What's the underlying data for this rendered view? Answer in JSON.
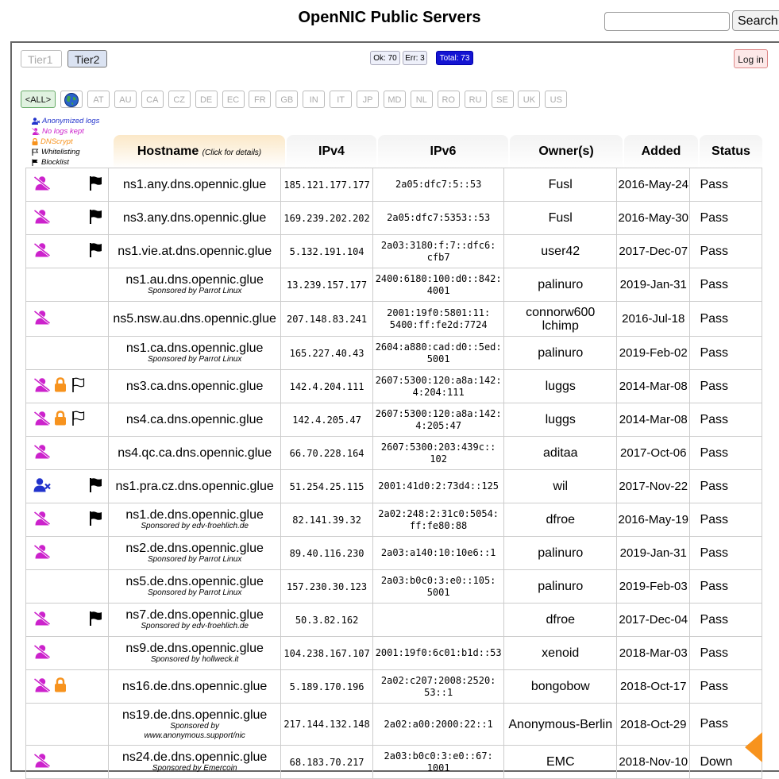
{
  "header": {
    "title": "OpenNIC Public Servers",
    "search_placeholder": "",
    "search_button": "Search"
  },
  "toolbar": {
    "tier1": "Tier1",
    "tier2": "Tier2",
    "stats": {
      "ok": "Ok: 70",
      "err": "Err: 3",
      "total": "Total: 73"
    },
    "login": "Log in"
  },
  "filters": {
    "all": "<ALL>",
    "countries": [
      "AT",
      "AU",
      "CA",
      "CZ",
      "DE",
      "EC",
      "FR",
      "GB",
      "IN",
      "IT",
      "JP",
      "MD",
      "NL",
      "RO",
      "RU",
      "SE",
      "UK",
      "US"
    ]
  },
  "legend": {
    "anonymized": "Anonymized logs",
    "no_logs": "No logs kept",
    "dnscrypt": "DNScrypt",
    "whitelisting": "Whitelisting",
    "blocklist": "Blocklist"
  },
  "colors": {
    "anonymized": "#2233cc",
    "no_logs": "#cc22cc",
    "dnscrypt": "#f7931e",
    "total_badge": "#1414d2",
    "down_arrow": "#f7931e"
  },
  "table": {
    "headers": {
      "hostname": "Hostname",
      "hostname_note": "(Click for details)",
      "ipv4": "IPv4",
      "ipv6": "IPv6",
      "owner": "Owner(s)",
      "added": "Added",
      "status": "Status"
    },
    "rows": [
      {
        "icons": [
          "no-logs",
          "",
          "blocklist"
        ],
        "host": "ns1.any.dns.opennic.glue",
        "sponsor": "",
        "ipv4": "185.121.177.177",
        "ipv6": [
          "2a05:dfc7:5::53"
        ],
        "owner": [
          "Fusl"
        ],
        "added": "2016-May-24",
        "status": "Pass"
      },
      {
        "icons": [
          "no-logs",
          "",
          "blocklist"
        ],
        "host": "ns3.any.dns.opennic.glue",
        "sponsor": "",
        "ipv4": "169.239.202.202",
        "ipv6": [
          "2a05:dfc7:5353::53"
        ],
        "owner": [
          "Fusl"
        ],
        "added": "2016-May-30",
        "status": "Pass"
      },
      {
        "icons": [
          "no-logs",
          "",
          "blocklist"
        ],
        "host": "ns1.vie.at.dns.opennic.glue",
        "sponsor": "",
        "ipv4": "5.132.191.104",
        "ipv6": [
          "2a03:3180:f:7::dfc6:",
          "cfb7"
        ],
        "owner": [
          "user42"
        ],
        "added": "2017-Dec-07",
        "status": "Pass"
      },
      {
        "icons": [
          "",
          "",
          ""
        ],
        "host": "ns1.au.dns.opennic.glue",
        "sponsor": "Sponsored by Parrot Linux",
        "ipv4": "13.239.157.177",
        "ipv6": [
          "2400:6180:100:d0::842:",
          "4001"
        ],
        "owner": [
          "palinuro"
        ],
        "added": "2019-Jan-31",
        "status": "Pass"
      },
      {
        "icons": [
          "no-logs",
          "",
          ""
        ],
        "host": "ns5.nsw.au.dns.opennic.glue",
        "sponsor": "",
        "ipv4": "207.148.83.241",
        "ipv6": [
          "2001:19f0:5801:11:",
          "5400:ff:fe2d:7724"
        ],
        "owner": [
          "connorw600",
          "lchimp"
        ],
        "added": "2016-Jul-18",
        "status": "Pass"
      },
      {
        "icons": [
          "",
          "",
          ""
        ],
        "host": "ns1.ca.dns.opennic.glue",
        "sponsor": "Sponsored by Parrot Linux",
        "ipv4": "165.227.40.43",
        "ipv6": [
          "2604:a880:cad:d0::5ed:",
          "5001"
        ],
        "owner": [
          "palinuro"
        ],
        "added": "2019-Feb-02",
        "status": "Pass"
      },
      {
        "icons": [
          "no-logs",
          "dnscrypt",
          "whitelist"
        ],
        "host": "ns3.ca.dns.opennic.glue",
        "sponsor": "",
        "ipv4": "142.4.204.111",
        "ipv6": [
          "2607:5300:120:a8a:142:",
          "4:204:111"
        ],
        "owner": [
          "luggs"
        ],
        "added": "2014-Mar-08",
        "status": "Pass"
      },
      {
        "icons": [
          "no-logs",
          "dnscrypt",
          "whitelist"
        ],
        "host": "ns4.ca.dns.opennic.glue",
        "sponsor": "",
        "ipv4": "142.4.205.47",
        "ipv6": [
          "2607:5300:120:a8a:142:",
          "4:205:47"
        ],
        "owner": [
          "luggs"
        ],
        "added": "2014-Mar-08",
        "status": "Pass"
      },
      {
        "icons": [
          "no-logs",
          "",
          ""
        ],
        "host": "ns4.qc.ca.dns.opennic.glue",
        "sponsor": "",
        "ipv4": "66.70.228.164",
        "ipv6": [
          "2607:5300:203:439c::",
          "102"
        ],
        "owner": [
          "aditaa"
        ],
        "added": "2017-Oct-06",
        "status": "Pass"
      },
      {
        "icons": [
          "anonymized",
          "",
          "blocklist"
        ],
        "host": "ns1.pra.cz.dns.opennic.glue",
        "sponsor": "",
        "ipv4": "51.254.25.115",
        "ipv6": [
          "2001:41d0:2:73d4::125"
        ],
        "owner": [
          "wil"
        ],
        "added": "2017-Nov-22",
        "status": "Pass"
      },
      {
        "icons": [
          "no-logs",
          "",
          "blocklist"
        ],
        "host": "ns1.de.dns.opennic.glue",
        "sponsor": "Sponsored by edv-froehlich.de",
        "ipv4": "82.141.39.32",
        "ipv6": [
          "2a02:248:2:31c0:5054:",
          "ff:fe80:88"
        ],
        "owner": [
          "dfroe"
        ],
        "added": "2016-May-19",
        "status": "Pass"
      },
      {
        "icons": [
          "no-logs",
          "",
          ""
        ],
        "host": "ns2.de.dns.opennic.glue",
        "sponsor": "Sponsored by Parrot Linux",
        "ipv4": "89.40.116.230",
        "ipv6": [
          "2a03:a140:10:10e6::1"
        ],
        "owner": [
          "palinuro"
        ],
        "added": "2019-Jan-31",
        "status": "Pass"
      },
      {
        "icons": [
          "",
          "",
          ""
        ],
        "host": "ns5.de.dns.opennic.glue",
        "sponsor": "Sponsored by Parrot Linux",
        "ipv4": "157.230.30.123",
        "ipv6": [
          "2a03:b0c0:3:e0::105:",
          "5001"
        ],
        "owner": [
          "palinuro"
        ],
        "added": "2019-Feb-03",
        "status": "Pass"
      },
      {
        "icons": [
          "no-logs",
          "",
          "blocklist"
        ],
        "host": "ns7.de.dns.opennic.glue",
        "sponsor": "Sponsored by edv-froehlich.de",
        "ipv4": "50.3.82.162",
        "ipv6": [
          ""
        ],
        "owner": [
          "dfroe"
        ],
        "added": "2017-Dec-04",
        "status": "Pass"
      },
      {
        "icons": [
          "no-logs",
          "",
          ""
        ],
        "host": "ns9.de.dns.opennic.glue",
        "sponsor": "Sponsored by hollweck.it",
        "ipv4": "104.238.167.107",
        "ipv6": [
          "2001:19f0:6c01:b1d::53"
        ],
        "owner": [
          "xenoid"
        ],
        "added": "2018-Mar-03",
        "status": "Pass"
      },
      {
        "icons": [
          "no-logs",
          "dnscrypt",
          ""
        ],
        "host": "ns16.de.dns.opennic.glue",
        "sponsor": "",
        "ipv4": "5.189.170.196",
        "ipv6": [
          "2a02:c207:2008:2520:",
          "53::1"
        ],
        "owner": [
          "bongobow"
        ],
        "added": "2018-Oct-17",
        "status": "Pass"
      },
      {
        "icons": [
          "",
          "",
          ""
        ],
        "host": "ns19.de.dns.opennic.glue",
        "sponsor": "Sponsored by",
        "sponsor2": "www.anonymous.support/nic",
        "ipv4": "217.144.132.148",
        "ipv6": [
          "2a02:a00:2000:22::1"
        ],
        "owner": [
          "Anonymous-Berlin"
        ],
        "added": "2018-Oct-29",
        "status": "Pass"
      },
      {
        "icons": [
          "no-logs",
          "",
          ""
        ],
        "host": "ns24.de.dns.opennic.glue",
        "sponsor": "Sponsored by Emercoin",
        "ipv4": "68.183.70.217",
        "ipv6": [
          "2a03:b0c0:3:e0::67:",
          "1001"
        ],
        "owner": [
          "EMC"
        ],
        "added": "2018-Nov-10",
        "status": "Down"
      }
    ]
  }
}
